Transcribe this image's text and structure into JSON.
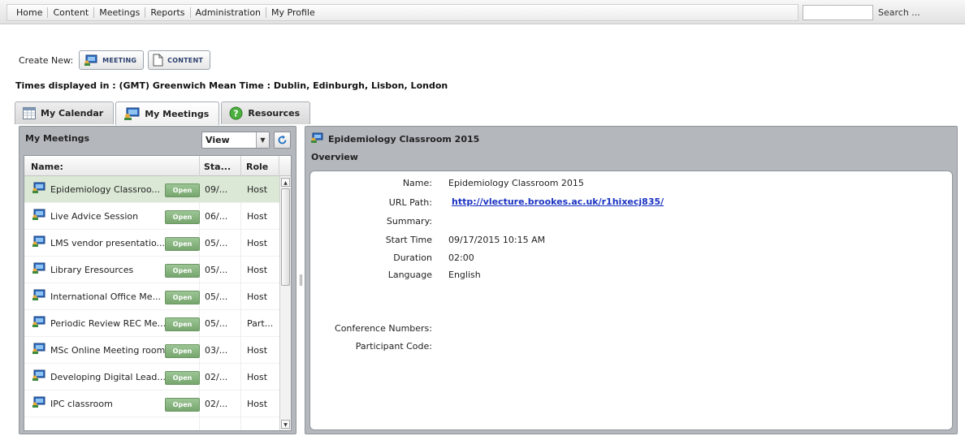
{
  "nav": {
    "items": [
      "Home",
      "Content",
      "Meetings",
      "Reports",
      "Administration",
      "My Profile"
    ],
    "search_label": "Search ..."
  },
  "create": {
    "label": "Create New:",
    "meeting_label": "MEETING",
    "content_label": "CONTENT"
  },
  "timezone": "Times displayed in : (GMT) Greenwich Mean Time : Dublin, Edinburgh, Lisbon, London",
  "tabs": [
    "My Calendar",
    "My Meetings",
    "Resources"
  ],
  "meetings_panel": {
    "title": "My Meetings",
    "view_label": "View",
    "columns": [
      "Name:",
      "Sta...",
      "Role"
    ],
    "open_label": "Open",
    "rows": [
      {
        "name": "Epidemiology Classroo...",
        "start": "09/...",
        "role": "Host"
      },
      {
        "name": "Live Advice Session",
        "start": "06/...",
        "role": "Host"
      },
      {
        "name": "LMS vendor presentatio...",
        "start": "05/...",
        "role": "Host"
      },
      {
        "name": "Library Eresources",
        "start": "05/...",
        "role": "Host"
      },
      {
        "name": "International Office Me...",
        "start": "05/...",
        "role": "Host"
      },
      {
        "name": "Periodic Review REC Me...",
        "start": "05/...",
        "role": "Part..."
      },
      {
        "name": "MSc Online Meeting room",
        "start": "03/...",
        "role": "Host"
      },
      {
        "name": "Developing Digital Lead...",
        "start": "02/...",
        "role": "Host"
      },
      {
        "name": "IPC classroom",
        "start": "02/...",
        "role": "Host"
      }
    ]
  },
  "detail": {
    "title": "Epidemiology Classroom 2015",
    "section": "Overview",
    "labels": {
      "name": "Name:",
      "url": "URL Path:",
      "summary": "Summary:",
      "start": "Start Time",
      "duration": "Duration",
      "language": "Language",
      "conference": "Conference Numbers:",
      "participant": "Participant Code:"
    },
    "values": {
      "name": "Epidemiology Classroom 2015",
      "url": "http://vlecture.brookes.ac.uk/r1hixecj835/",
      "start": "09/17/2015 10:15 AM",
      "duration": "02:00",
      "language": "English"
    }
  },
  "colors": {
    "open_button": "#7fae76",
    "selected_row": "#dbe8d6",
    "panel": "#b4b8bd",
    "link": "#1a33c2"
  }
}
